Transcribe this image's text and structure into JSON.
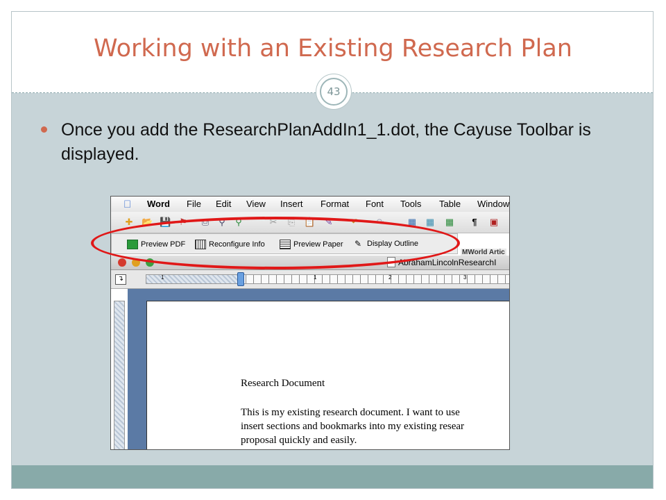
{
  "slide": {
    "title": "Working with an Existing Research Plan",
    "number": "43",
    "bullet": "Once you add the ResearchPlanAddIn1_1.dot, the Cayuse Toolbar is displayed."
  },
  "screenshot": {
    "menu": [
      "Word",
      "File",
      "Edit",
      "View",
      "Insert",
      "Format",
      "Font",
      "Tools",
      "Table",
      "Window"
    ],
    "cayuse_toolbar": {
      "preview_pdf": "Preview PDF",
      "reconfigure_info": "Reconfigure Info",
      "preview_paper": "Preview Paper",
      "display_outline": "Display Outline"
    },
    "side_tab_label": "MWorld Artic",
    "doc_window_title": "AbrahamLincolnResearchI",
    "ruler_numbers": [
      "1",
      "1",
      "2",
      "3"
    ],
    "document": {
      "heading": "Research Document",
      "line1": "This is my existing research document.   I want to use",
      "line2": "insert sections and bookmarks into my existing resear",
      "line3": "proposal quickly and easily."
    }
  },
  "colors": {
    "title": "#d0694f",
    "content_bg": "#c7d4d8",
    "footer": "#88aaa9",
    "highlight": "#e01818"
  }
}
